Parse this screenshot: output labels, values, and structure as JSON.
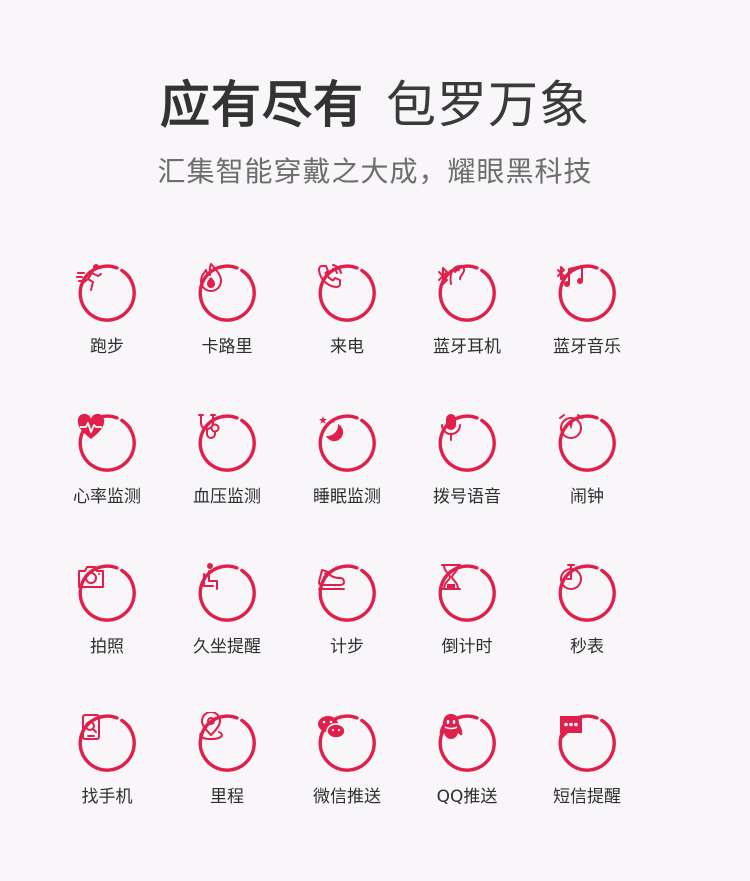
{
  "header": {
    "title_bold": "应有尽有",
    "title_light": "包罗万象",
    "subtitle": "汇集智能穿戴之大成，耀眼黑科技"
  },
  "accent_color": "#e0204a",
  "features": [
    {
      "label": "跑步",
      "icon": "running-icon"
    },
    {
      "label": "卡路里",
      "icon": "flame-icon"
    },
    {
      "label": "来电",
      "icon": "incoming-call-icon"
    },
    {
      "label": "蓝牙耳机",
      "icon": "bluetooth-headset-icon"
    },
    {
      "label": "蓝牙音乐",
      "icon": "bluetooth-music-icon"
    },
    {
      "label": "心率监测",
      "icon": "heart-rate-icon"
    },
    {
      "label": "血压监测",
      "icon": "stethoscope-icon"
    },
    {
      "label": "睡眠监测",
      "icon": "moon-stars-icon"
    },
    {
      "label": "拨号语音",
      "icon": "microphone-icon"
    },
    {
      "label": "闹钟",
      "icon": "alarm-clock-icon"
    },
    {
      "label": "拍照",
      "icon": "camera-icon"
    },
    {
      "label": "久坐提醒",
      "icon": "sitting-person-icon"
    },
    {
      "label": "计步",
      "icon": "shoe-icon"
    },
    {
      "label": "倒计时",
      "icon": "hourglass-icon"
    },
    {
      "label": "秒表",
      "icon": "stopwatch-icon"
    },
    {
      "label": "找手机",
      "icon": "find-phone-icon"
    },
    {
      "label": "里程",
      "icon": "location-pin-icon"
    },
    {
      "label": "微信推送",
      "icon": "wechat-icon"
    },
    {
      "label": "QQ推送",
      "icon": "qq-icon"
    },
    {
      "label": "短信提醒",
      "icon": "sms-icon"
    }
  ]
}
